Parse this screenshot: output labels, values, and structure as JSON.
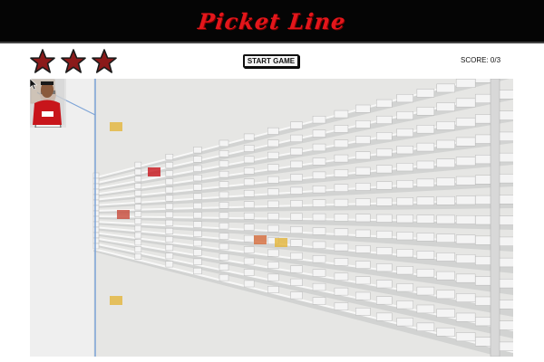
{
  "header": {
    "title": "Picket Line"
  },
  "toolbar": {
    "stars": [
      "star-1",
      "star-2",
      "star-3"
    ],
    "start_button_label": "START GAME",
    "score_text": "SCORE: 0/3"
  },
  "game": {
    "background": "warehouse-shelves",
    "item": "cardboard-box",
    "enemy": "boss-character",
    "player": "worker-character"
  },
  "colors": {
    "header_bg": "#050505",
    "title": "#e3161b",
    "star_fill": "#8b1a1a",
    "star_outline": "#1a1a1a",
    "box": "#b9824a",
    "shelf_bg": "#e6e6e4"
  }
}
